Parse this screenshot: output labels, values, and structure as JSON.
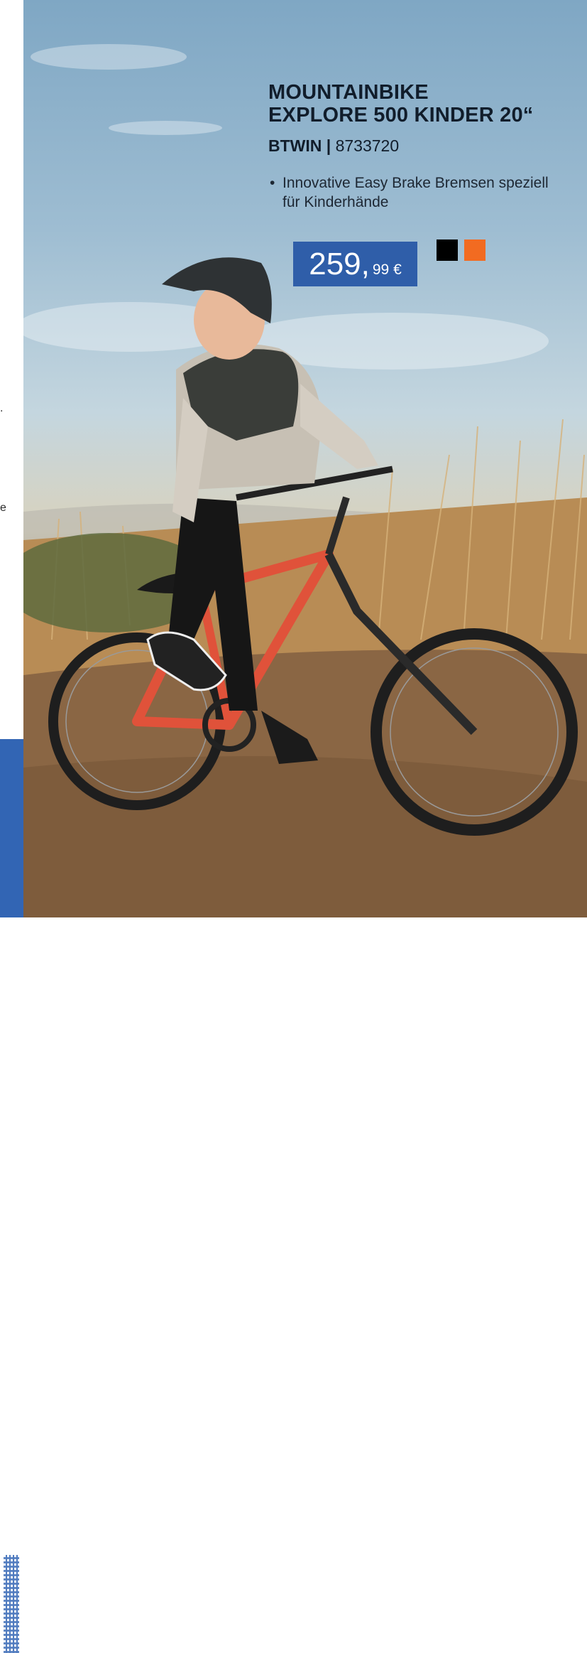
{
  "left_column": {
    "fragments": [
      ".",
      "e"
    ]
  },
  "product": {
    "title_line1": "MOUNTAINBIKE",
    "title_line2": "EXPLORE 500 KINDER 20“",
    "brand": "BTWIN",
    "separator": "|",
    "article_number": "8733720",
    "bullet_symbol": "•",
    "feature": "Innovative Easy Brake Bremsen speziell für Kinderhände",
    "price_main": "259,",
    "price_cents": "99 €",
    "colors": [
      {
        "name": "black",
        "hex": "#000000"
      },
      {
        "name": "orange",
        "hex": "#f26b21"
      }
    ]
  },
  "accent_colors": {
    "price_background": "#2f5ea9",
    "sidebar_blue": "#3265b4"
  }
}
